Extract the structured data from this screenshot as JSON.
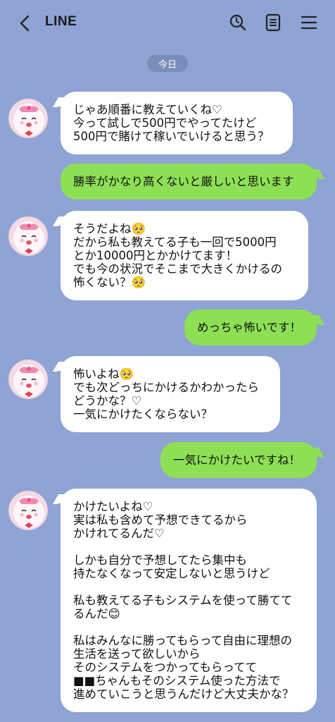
{
  "header": {
    "title": "LINE",
    "icons": [
      "back-chevron-icon",
      "search-icon",
      "notes-icon",
      "menu-icon"
    ]
  },
  "date_chip": "今日",
  "colors": {
    "background": "#8fa3d4",
    "incoming": "#ffffff",
    "outgoing": "#8de055",
    "date_chip": "#7a8cb8"
  },
  "messages": [
    {
      "side": "in",
      "lines": [
        "じゃあ順番に教えていくね♡",
        "今って試しで500円でやってたけど",
        "500円で賭けて稼いでいけると思う？"
      ]
    },
    {
      "side": "out",
      "lines": [
        "勝率がかなり高くないと厳しいと思います"
      ]
    },
    {
      "side": "in",
      "lines": [
        "そうだよね🥺",
        "だから私も教えてる子も一回で5000円",
        "とか10000円とかかけてます！",
        "でも今の状況でそこまで大きくかけるの",
        "怖くない？🥺"
      ]
    },
    {
      "side": "out",
      "lines": [
        "めっちゃ怖いです！"
      ]
    },
    {
      "side": "in",
      "lines": [
        "怖いよね🥺",
        "でも次どっちにかけるかわかったら",
        "どうかな？♡",
        "一気にかけたくならない？"
      ]
    },
    {
      "side": "out",
      "lines": [
        "一気にかけたいですね！"
      ]
    },
    {
      "side": "in",
      "lines": [
        "かけたいよね♡",
        "実は私も含めて予想できてるから",
        "かけれてるんだ♡",
        "",
        "しかも自分で予想してたら集中も",
        "持たなくなって安定しないと思うけど",
        "",
        "私も教えてる子もシステムを使って勝てて",
        "るんだ😊",
        "",
        "私はみんなに勝ってもらって自由に理想の",
        "生活を送って欲しいから",
        "そのシステムをつかってもらってて",
        "■■ちゃんもそのシステム使った方法で",
        "進めていこうと思うんだけど大丈夫かな？"
      ]
    }
  ]
}
